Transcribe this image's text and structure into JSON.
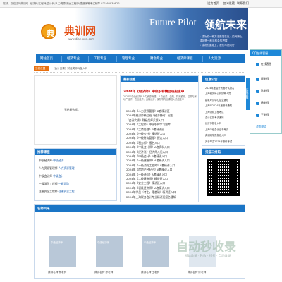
{
  "topbar": {
    "notice": "您好，欢迎访问典训网--经济师/工程师/会计师/人力资源/安全工程师/建造师等考试辅导 021-60939822",
    "links": [
      "设为首页",
      "加入收藏",
      "联系我们"
    ]
  },
  "logo": {
    "name": "典训网",
    "url": "www.dian-xun.com",
    "badge": "典"
  },
  "banner": {
    "slogan_en": "Future Pilot",
    "slogan_cn": "领航未来",
    "bullets": [
      "▸ 成功的一种方法是站在巨人的肩膀上",
      "成功是一种对机会的把握",
      "▸ 成功的道路上，我们与您同行"
    ]
  },
  "nav": [
    "网站首页",
    "经济专业",
    "工程专业",
    "管理专业",
    "财会专业",
    "经济师课程",
    "人力资源"
  ],
  "breadcrumb": {
    "label": "当前位置",
    "path": "《会计实操》财经类师兵部入口"
  },
  "main_empty": "无结果数据。",
  "news": {
    "title": "最新信息",
    "headline": "2024年《经济师》中级职称精品班招生中！",
    "intro": "2024年中级经济师人力资源管理、人力资源、金融、财政税收、建筑与房地产经济、农业经济、运输经济、保险等专业课程火热招生中",
    "items": [
      "2024年《人力资源管理》B套精讲班",
      "2024年经济师精品班《经济基础》招生",
      "《会计实操》财经类师兵部入口",
      "2024年《工程师》中级职称学习题库",
      "2024年《工商管理》B套精讲班",
      "2024年《中级会计》精讲班入口",
      "2024年《中级财务管理》报名入口",
      "2024年《税务师》报名入口",
      "2024年《中级会计师》A套资料入口",
      "2024年《经济法》经济师入门入口",
      "2024年《中级会计》B套精讲入口",
      "2024年《一级建造师》A套精讲入口",
      "2024年《一级消防工程师》A套精讲入口",
      "2024年《房地产经纪人》A套精讲入口",
      "2024年《一级造价》A套精讲入口",
      "2024年《二级建造师》精讲班入口",
      "2024年《安全工程》精讲班入口",
      "2024年《初级经济师》A套精讲入口",
      "2024年学员（考生，零基础）精讲班入口",
      "2024年上海税务会计专业精讲班报名通知"
    ]
  },
  "recommend": {
    "title": "推荐课程",
    "rows": [
      {
        "a": "中级经济师",
        "b": "·中级经济"
      },
      {
        "a": "人力资源管理师",
        "b": "·人力资源管理"
      },
      {
        "a": "中级会计师",
        "b": "·中级会计"
      },
      {
        "a": "一级消防工程师",
        "b": "·一级消防"
      },
      {
        "a": "注册安全工程师",
        "b": "·注册安全工程"
      }
    ]
  },
  "announce": {
    "title": "信息公告",
    "items": [
      "2024年度会计资格考试报名",
      "上海税务局公开招聘人员",
      "建筑考试中心招生通知",
      "上海市2024年度报考通知",
      "上海消防工程考试",
      "会计实操考试通知",
      "经济师报名入口",
      "上海中级会计证书考试",
      "典训网学员报名入口",
      "关于举办2024年职称考试"
    ]
  },
  "qrcode": {
    "title": "扫描二维码"
  },
  "sidebar": {
    "title": "QQ在线客服",
    "online": "在线客服",
    "agents": [
      "顾老师",
      "陈老师",
      "杨老师",
      "王老师"
    ],
    "tab": "在线客服",
    "wechat": "咨询电话"
  },
  "teachers": {
    "title": "名师风采",
    "caps": [
      "典训名师·杨老师",
      "典训名师·孙老师",
      "典训名师·王老师",
      "典训名师·陈老师"
    ],
    "photo_labels": [
      "中级经济师",
      "中级经济师",
      "中级经济师",
      ""
    ]
  },
  "watermark": {
    "title": "自动秒收录",
    "sub": "网站收录 · 秒收 · 排名 · 自动收录"
  }
}
